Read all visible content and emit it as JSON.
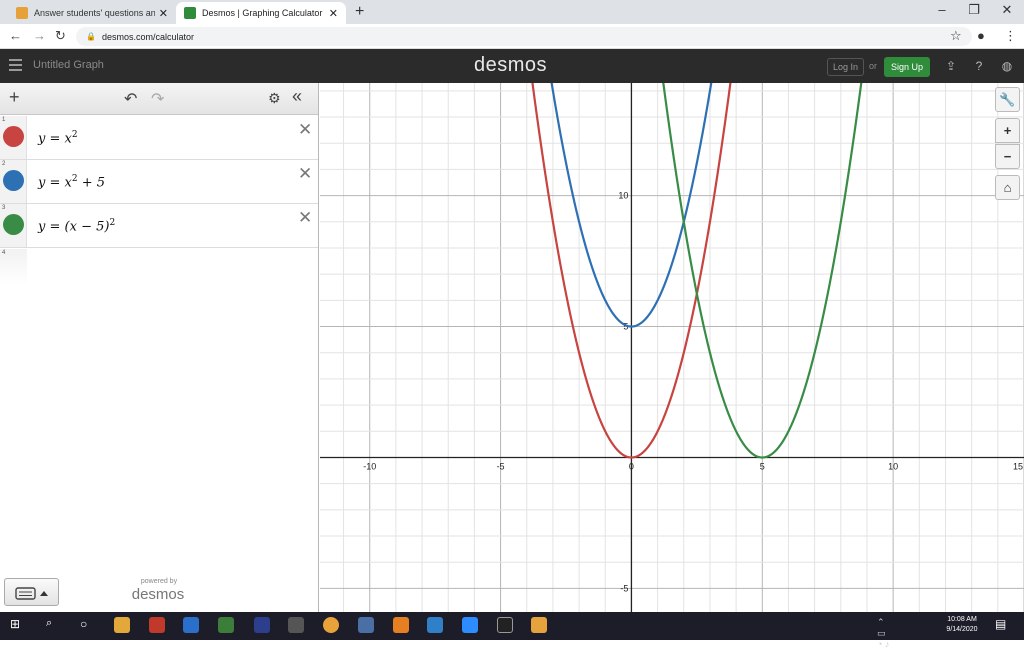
{
  "browser": {
    "tabs": [
      {
        "title": "Answer students' questions and i",
        "active": false
      },
      {
        "title": "Desmos | Graphing Calculator",
        "active": true
      }
    ],
    "url": "desmos.com/calculator"
  },
  "desmos_header": {
    "graph_title": "Untitled Graph",
    "brand": "desmos",
    "login_label": "Log In",
    "or_label": "or",
    "signup_label": "Sign Up"
  },
  "expressions": [
    {
      "index": "1",
      "lhs": "y",
      "eq": "=",
      "base": "x",
      "exp": "2",
      "rest": "",
      "color": "#c74440"
    },
    {
      "index": "2",
      "lhs": "y",
      "eq": "=",
      "base": "x",
      "exp": "2",
      "rest": " + 5",
      "color": "#2d70b3"
    },
    {
      "index": "3",
      "lhs": "y",
      "eq": "=",
      "base": "(x − 5)",
      "exp": "2",
      "rest": "",
      "color": "#388c46"
    }
  ],
  "empty_row_index": "4",
  "footer": {
    "powered_by": "powered by",
    "logo": "desmos"
  },
  "chart_data": {
    "type": "line",
    "xlim": [
      -11.9,
      15
    ],
    "ylim": [
      -5.9,
      14.3
    ],
    "x_ticks": [
      -10,
      -5,
      0,
      5,
      10,
      15
    ],
    "y_ticks": [
      -5,
      5,
      10
    ],
    "x_tick_labels": [
      "-10",
      "-5",
      "0",
      "5",
      "10",
      "15"
    ],
    "y_tick_labels": [
      "-5",
      "5",
      "10"
    ],
    "grid": true,
    "series": [
      {
        "expr": "x^2",
        "a": 1,
        "h": 0,
        "k": 0,
        "color": "#c74440"
      },
      {
        "expr": "x^2+5",
        "a": 1,
        "h": 0,
        "k": 5,
        "color": "#2d70b3"
      },
      {
        "expr": "(x-5)^2",
        "a": 1,
        "h": 5,
        "k": 0,
        "color": "#388c46"
      }
    ]
  },
  "taskbar": {
    "time": "10:08 AM",
    "date": "9/14/2020"
  }
}
